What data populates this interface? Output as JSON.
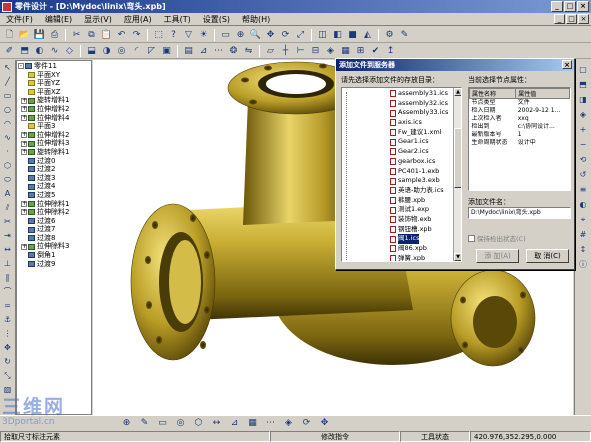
{
  "window": {
    "title": "零件设计 - [D:\\Mydoc\\linix\\弯头.xpb]"
  },
  "menu": {
    "items": [
      "文件(F)",
      "编辑(E)",
      "显示(V)",
      "应用(A)",
      "工具(T)",
      "设置(S)",
      "帮助(H)"
    ]
  },
  "tree": {
    "items": [
      {
        "label": "零件11",
        "expand": "-",
        "kind": "part"
      },
      {
        "label": "平面XY",
        "expand": "",
        "kind": "plane"
      },
      {
        "label": "平面YZ",
        "expand": "",
        "kind": "plane"
      },
      {
        "label": "平面XZ",
        "expand": "",
        "kind": "plane"
      },
      {
        "label": "旋转增料1",
        "expand": "+",
        "kind": "feat"
      },
      {
        "label": "拉伸增料2",
        "expand": "+",
        "kind": "feat"
      },
      {
        "label": "拉伸增料4",
        "expand": "+",
        "kind": "feat"
      },
      {
        "label": "平面3",
        "expand": "",
        "kind": "plane"
      },
      {
        "label": "拉伸增料2",
        "expand": "+",
        "kind": "feat"
      },
      {
        "label": "拉伸增料3",
        "expand": "+",
        "kind": "feat"
      },
      {
        "label": "旋转除料1",
        "expand": "+",
        "kind": "feat"
      },
      {
        "label": "过渡0",
        "expand": "",
        "kind": "op"
      },
      {
        "label": "过渡2",
        "expand": "",
        "kind": "op"
      },
      {
        "label": "过渡3",
        "expand": "",
        "kind": "op"
      },
      {
        "label": "过渡4",
        "expand": "",
        "kind": "op"
      },
      {
        "label": "过渡5",
        "expand": "",
        "kind": "op"
      },
      {
        "label": "拉伸除料1",
        "expand": "+",
        "kind": "feat"
      },
      {
        "label": "拉伸除料2",
        "expand": "+",
        "kind": "feat"
      },
      {
        "label": "过渡6",
        "expand": "",
        "kind": "op"
      },
      {
        "label": "过渡7",
        "expand": "",
        "kind": "op"
      },
      {
        "label": "过渡8",
        "expand": "",
        "kind": "op"
      },
      {
        "label": "拉伸除料3",
        "expand": "+",
        "kind": "feat"
      },
      {
        "label": "倒角1",
        "expand": "",
        "kind": "op"
      },
      {
        "label": "过渡9",
        "expand": "",
        "kind": "op"
      }
    ]
  },
  "dialog": {
    "title": "添加文件到服务器",
    "folder_prompt": "请先选择添加文件的存放目录：",
    "props_prompt": "当前选择节点属性：",
    "files": [
      "assembly31.ics",
      "assembly32.ics",
      "Assembly33.ics",
      "axis.ics",
      "Fw_建议1.xml",
      "Gear1.ics",
      "Gear2.ics",
      "gearbox.ics",
      "PC401-1.exb",
      "sample3.exb",
      "英语-助力表.ics",
      "裤腰.xpb",
      "测试1.exp",
      "装饰物.exb",
      "钢钮槽.xpb",
      "阀1.ics",
      "阀86.xpb",
      "弹簧.xpb"
    ],
    "selected_file_index": 15,
    "props_headers": [
      "属性名称",
      "属性值"
    ],
    "props_rows": [
      [
        "节点类型",
        "文件"
      ],
      [
        "检入日期",
        "2002-9-12 1..."
      ],
      [
        "上次检入者",
        "xxq"
      ],
      [
        "检出到",
        "c:\\协同设计..."
      ],
      [
        "最新版本号",
        "1"
      ],
      [
        "生命周期状态",
        "设计中"
      ]
    ],
    "filename_label": "添加文件名：",
    "filename_value": "D:\\Mydoc\\linix\\弯头.xpb",
    "keep_checkout_label": "保持检出状态(C)",
    "add_button": "添 加(A)",
    "cancel_button": "取 消(C)"
  },
  "statusbar": {
    "hint": "拾取尺寸标注元素",
    "status_label": "修改指令",
    "tool_label": "工具状态",
    "coords": "420.976,352.295,0.000"
  },
  "watermark": {
    "line1": "三维网",
    "line2": "3Dportal.cn"
  },
  "colors": {
    "model_gold": "#b8a02a",
    "title_blue": "#0a246a",
    "chrome": "#d4d0c8"
  }
}
